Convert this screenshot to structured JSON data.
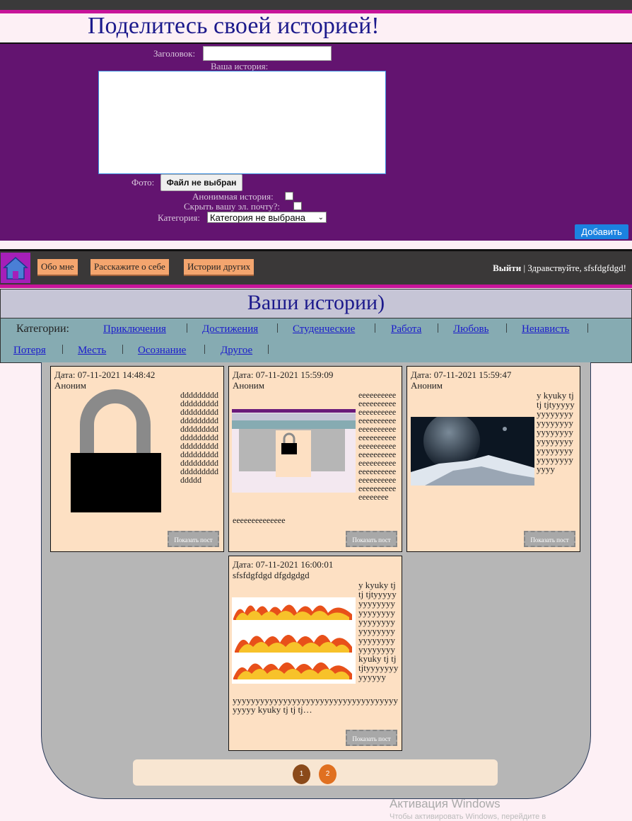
{
  "share_form": {
    "title": "Поделитесь своей историей!",
    "title_label": "Заголовок:",
    "story_label": "Ваша история:",
    "photo_label": "Фото:",
    "file_button": "Файл не выбран",
    "anonymous_label": "Анонимная история:",
    "hide_email_label": "Скрыть вашу эл. почту?:",
    "category_label": "Категория:",
    "category_selected": "Категория не выбрана",
    "submit": "Добавить"
  },
  "nav": {
    "items": [
      "Обо мне",
      "Расскажите о себе",
      "Истории других"
    ],
    "logout": "Выйти",
    "greeting": "| Здравствуйте, sfsfdgfdgd!"
  },
  "stories": {
    "title": "Ваши истории)",
    "categories_label": "Категории:",
    "categories": [
      "Приключения",
      "Достижения",
      "Студенческие",
      "Работа",
      "Любовь",
      "Ненависть",
      "Потеря",
      "Месть",
      "Осознание",
      "Другое"
    ],
    "cards": [
      {
        "date": "Дата: 07-11-2021 14:48:42",
        "author": "Аноним",
        "text": "ddddddddddddddddddddddddddddddddddddddddddddddddddddddddddddddddddddddddddddddddddddddddddddddd",
        "button": "Показать пост",
        "image": "lock-image"
      },
      {
        "date": "Дата: 07-11-2021 15:59:09",
        "author": "Аноним",
        "text": "eeeeeeeeeeeeeeeeeeeeeeeeeeeeeeeeeeeeeeeeeeeeeeeeeeeeeeeeeeeeeeeeeeeeeeeeeeeeeeeeeeeeeeeeeeeeeeeeeeeeeeeeeeeeeeeeeeeeeeeeeeeeeeee",
        "text_tail": "eeeeeeeeeeeeee",
        "button": "Показать пост",
        "image": "screenshot-image"
      },
      {
        "date": "Дата: 07-11-2021 15:59:47",
        "author": "Аноним",
        "text": "y kyuky tj tj tjtyyyyyyyyyyyyyyyyyyyyyyyyyyyyyyyyyyyyyyyyyyyyyyyyyyyyyyyyy",
        "button": "Показать пост",
        "image": "planet-image"
      },
      {
        "date": "Дата: 07-11-2021 16:00:01",
        "author": "sfsfdgfdgd dfgdgdgd",
        "text": "y kyuky tj tj tjtyyyyyyyyyyyyyyyyyyyyyyyyyyyyyyyyyyyyyyyyyyyyyyyyyyyyy kyuky tj tj tjtyyyyyyyyyyyyy",
        "text_tail": "yyyyyyyyyyyyyyyyyyyyyyyyyyyyyyyyyyyyyyyyy kyuky tj tj tj…",
        "button": "Показать пост",
        "image": "flames-image"
      }
    ]
  },
  "pagination": {
    "pages": [
      "1",
      "2"
    ],
    "current": "2"
  },
  "watermark": {
    "line1": "Активация Windows",
    "line2": "Чтобы активировать Windows, перейдите в"
  },
  "colors": {
    "form_bg": "#631470",
    "accent": "#c8149a",
    "card_bg": "#fde0c3",
    "title_color": "#1c1a8c"
  }
}
